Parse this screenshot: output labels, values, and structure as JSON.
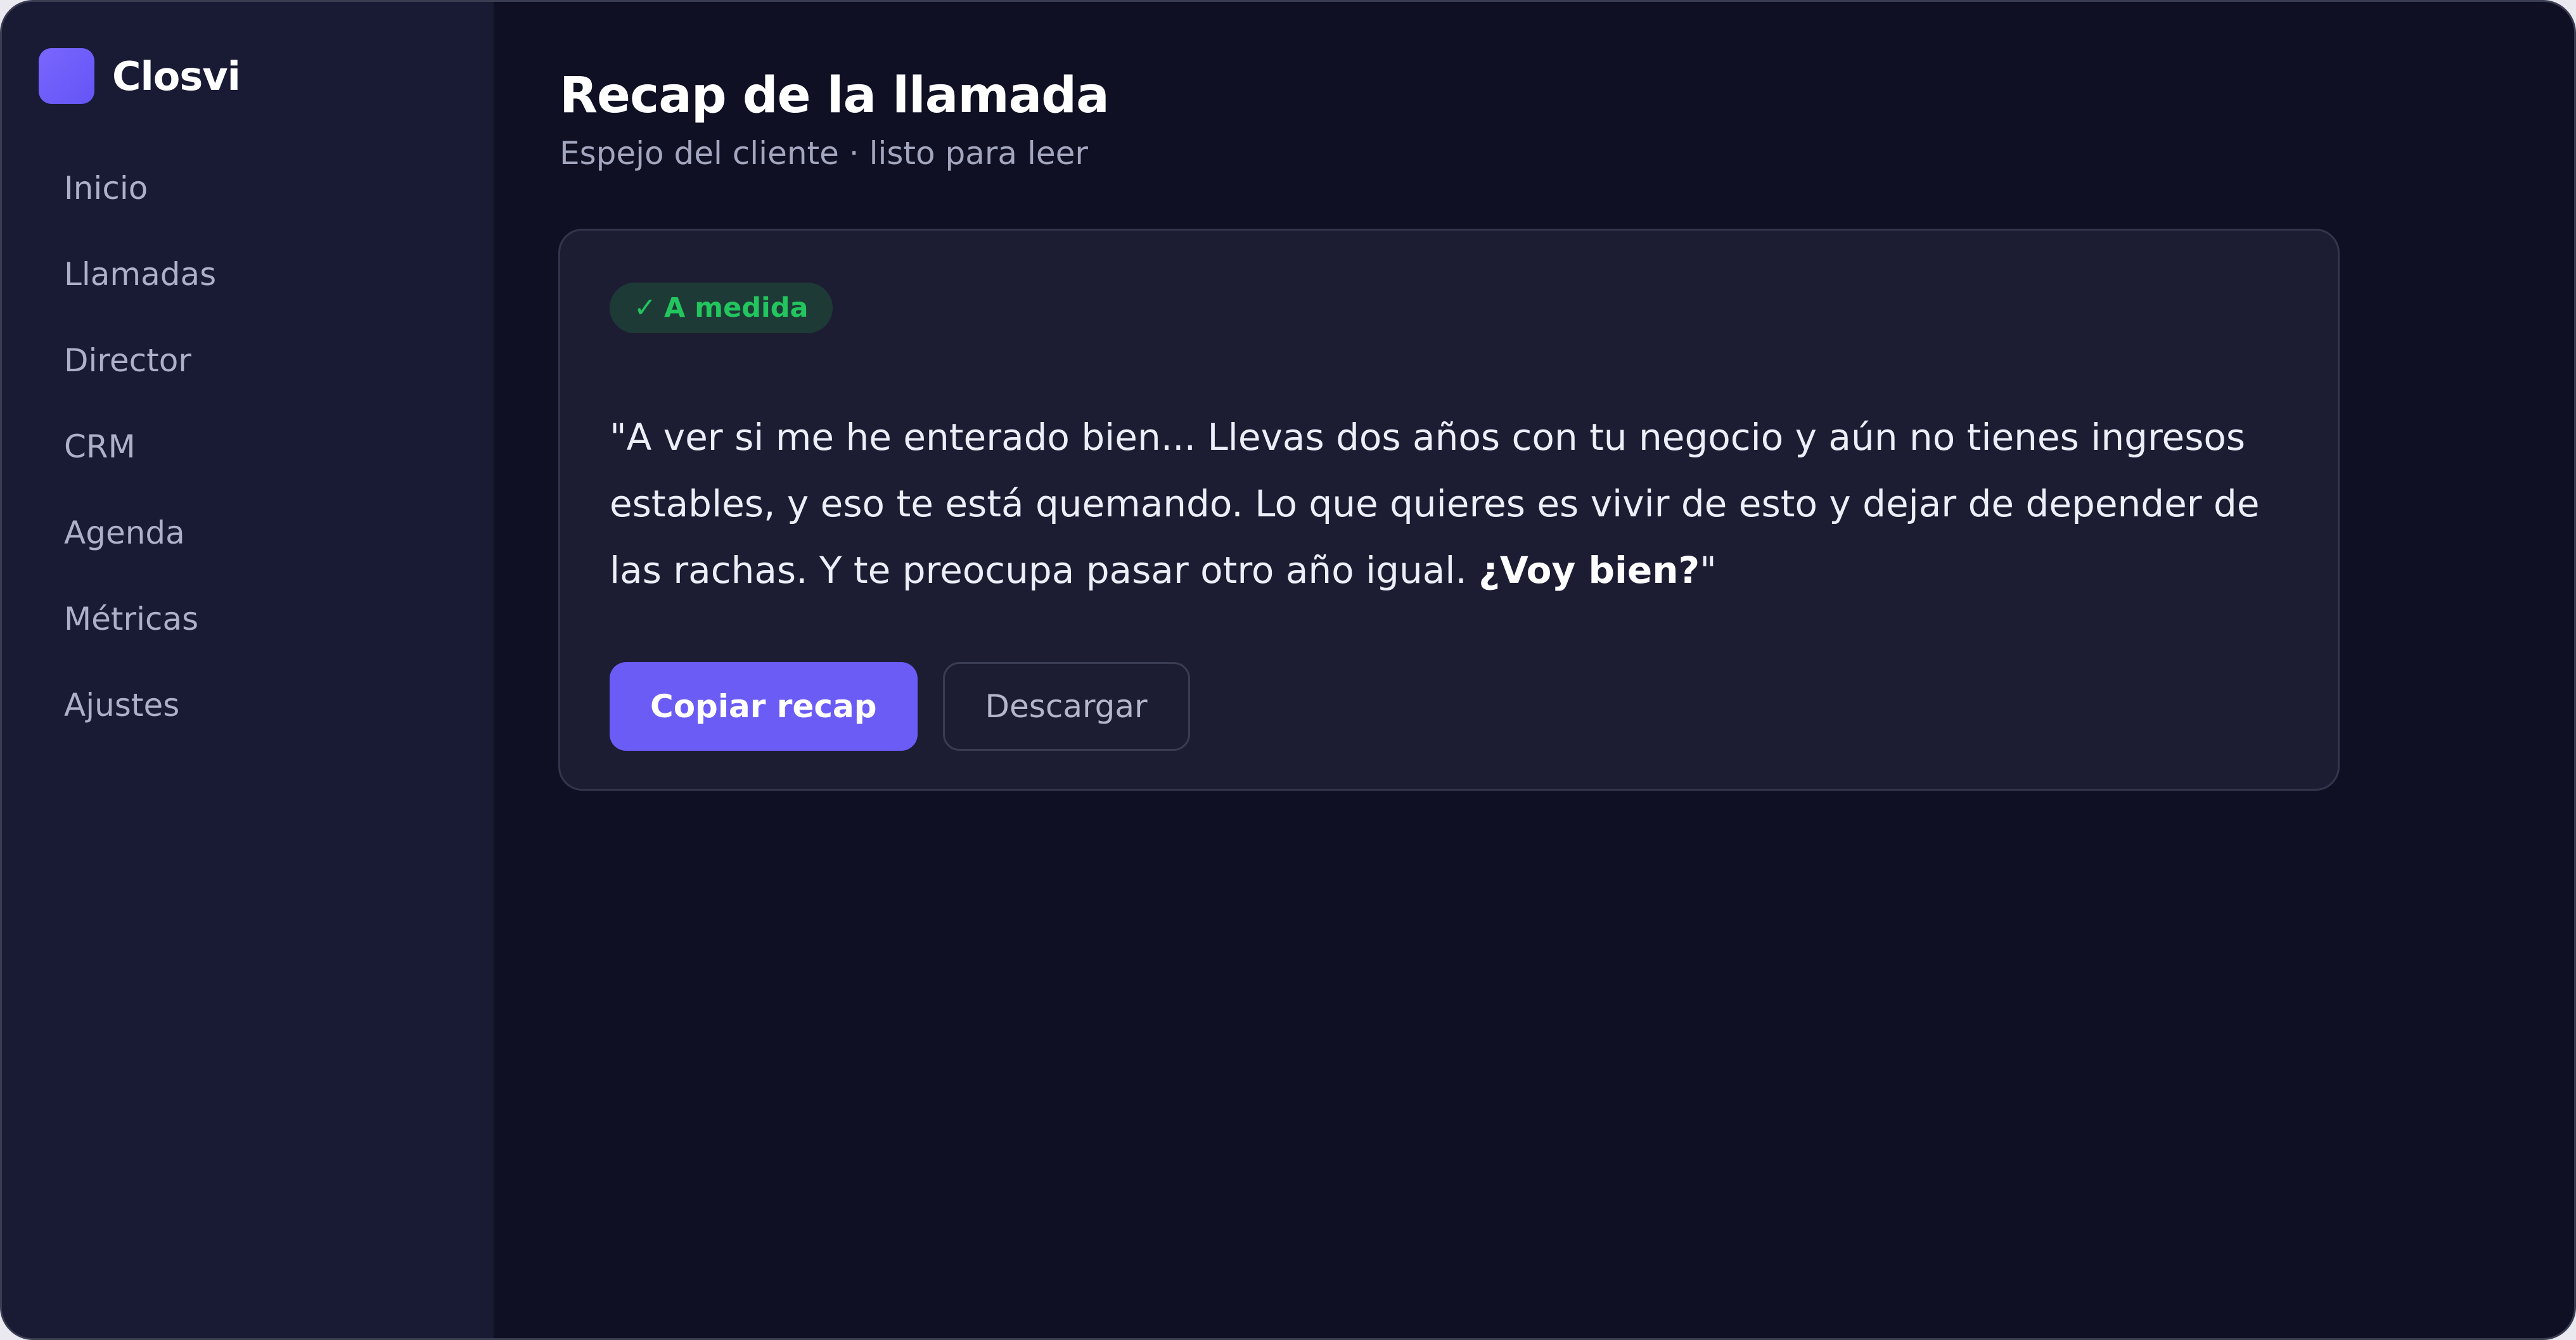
{
  "brand": {
    "name": "Closvi",
    "logo_color": "#6f5dfb"
  },
  "sidebar": {
    "items": [
      {
        "label": "Inicio"
      },
      {
        "label": "Llamadas"
      },
      {
        "label": "Director"
      },
      {
        "label": "CRM"
      },
      {
        "label": "Agenda"
      },
      {
        "label": "Métricas"
      },
      {
        "label": "Ajustes"
      }
    ]
  },
  "header": {
    "title": "Recap de la llamada",
    "subtitle": "Espejo del cliente · listo para leer"
  },
  "card": {
    "badge": {
      "icon": "check-icon",
      "check": "✓",
      "label": "A medida",
      "color": "#22c55e"
    },
    "recap": {
      "text": "\"A ver si me he enterado bien... Llevas dos años con tu negocio y aún no tienes ingresos estables, y eso te está quemando. Lo que quieres es vivir de esto y dejar de depender de las rachas. Y te preocupa pasar otro año igual. ",
      "emphasis": "¿Voy bien?",
      "closing": "\""
    },
    "actions": {
      "copy_label": "Copiar recap",
      "download_label": "Descargar"
    }
  },
  "colors": {
    "accent": "#6c5cf6",
    "background": "#0f1023",
    "sidebar": "#191a34",
    "card": "#1c1d33"
  }
}
